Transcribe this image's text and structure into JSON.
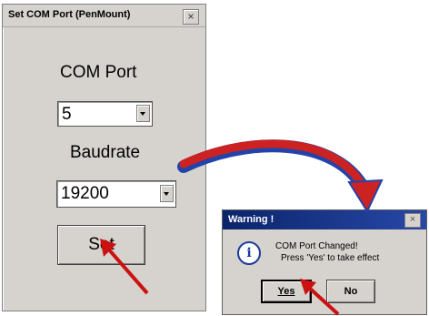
{
  "com_window": {
    "title": "Set COM Port (PenMount)",
    "close_glyph": "×",
    "com_port_label": "COM Port",
    "com_port_value": "5",
    "baudrate_label": "Baudrate",
    "baudrate_value": "19200",
    "set_button_label": "Set"
  },
  "warning_dialog": {
    "title": "Warning !",
    "close_glyph": "×",
    "icon": "info-icon",
    "icon_glyph": "i",
    "message_line1": "COM Port Changed!",
    "message_line2": "Press 'Yes' to take effect",
    "yes_label": "Yes",
    "no_label": "No"
  },
  "annotations": {
    "arrow_color": "#cc1111",
    "curve_color": "#cc2222",
    "curve_highlight_color": "#2244aa"
  }
}
